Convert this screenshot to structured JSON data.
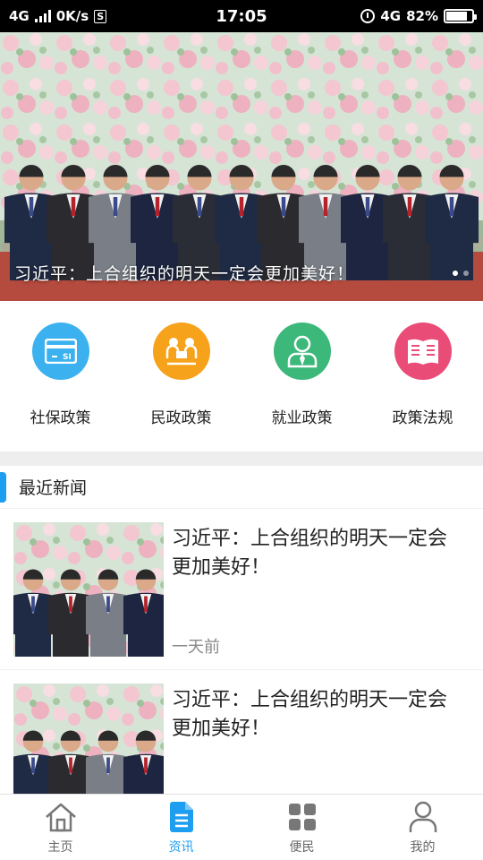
{
  "status_bar": {
    "network": "4G",
    "speed": "0K/s",
    "s_badge": "S",
    "time": "17:05",
    "network_right": "4G",
    "battery": "82%",
    "battery_level": 0.82
  },
  "banner": {
    "caption": "习近平：上合组织的明天一定会更加美好！",
    "slides": 2,
    "active_slide": 1
  },
  "categories": [
    {
      "label": "社保政策",
      "icon": "social-security-card-icon",
      "color": "#3bb2ef"
    },
    {
      "label": "民政政策",
      "icon": "meeting-people-icon",
      "color": "#f7a21b"
    },
    {
      "label": "就业政策",
      "icon": "employee-icon",
      "color": "#3cb87a"
    },
    {
      "label": "政策法规",
      "icon": "book-icon",
      "color": "#ea4c78"
    }
  ],
  "news": {
    "header": "最近新闻",
    "accent": "#1e9ef0",
    "items": [
      {
        "title": "习近平：上合组织的明天一定会更加美好！",
        "time": "一天前"
      },
      {
        "title": "习近平：上合组织的明天一定会更加美好！",
        "time": ""
      }
    ]
  },
  "tabbar": {
    "active_color": "#1e9ef0",
    "tabs": [
      {
        "label": "主页",
        "icon": "home-icon",
        "active": false
      },
      {
        "label": "资讯",
        "icon": "news-document-icon",
        "active": true
      },
      {
        "label": "便民",
        "icon": "grid-apps-icon",
        "active": false
      },
      {
        "label": "我的",
        "icon": "user-icon",
        "active": false
      }
    ]
  }
}
